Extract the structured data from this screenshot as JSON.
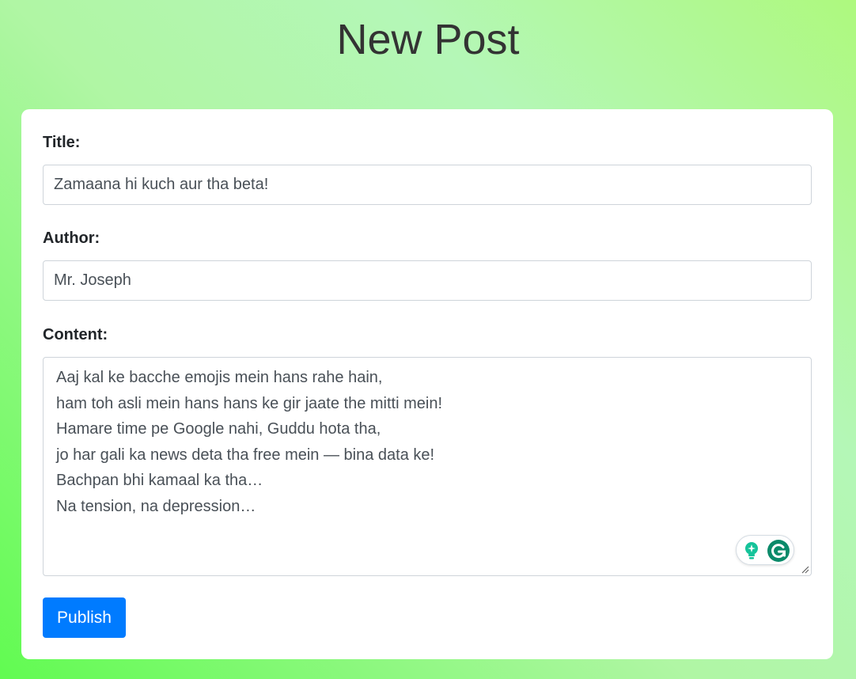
{
  "page": {
    "title": "New Post"
  },
  "form": {
    "title_label": "Title:",
    "title_value": "Zamaana hi kuch aur tha beta!",
    "author_label": "Author:",
    "author_value": "Mr. Joseph",
    "content_label": "Content:",
    "content_lines": [
      "Aaj kal ke bacche emojis mein hans rahe hain,",
      "ham toh asli mein hans hans ke gir jaate the mitti mein!",
      "Hamare time pe Google nahi, Guddu hota tha,",
      "jo har gali ka news deta tha free mein — bina data ke!",
      "Bachpan bhi kamaal ka tha…",
      "Na tension, na depression…"
    ],
    "submit_label": "Publish"
  },
  "icons": {
    "grammarly_suggestion": "lightbulb-icon",
    "grammarly_logo": "grammarly-g-icon",
    "resize": "resize-handle-icon"
  },
  "colors": {
    "accent": "#007bff",
    "grammarly": "#15c39a",
    "grammarly_dark": "#0b8a6a"
  }
}
